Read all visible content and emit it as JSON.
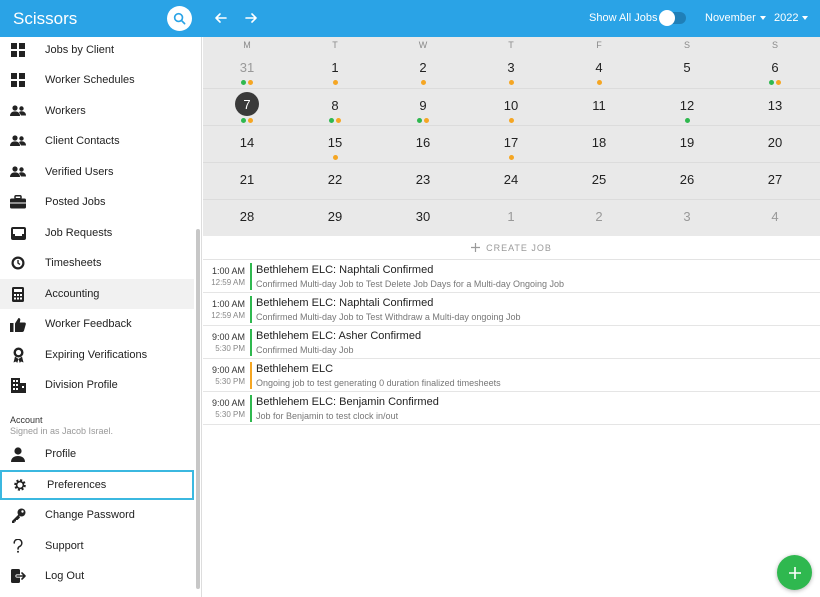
{
  "topbar": {
    "title": "Scissors",
    "show_all_jobs_label": "Show All Jobs",
    "show_all_jobs_on": false,
    "month": "November",
    "year": "2022",
    "accent": "#2aa3e6"
  },
  "sidebar": {
    "items": [
      {
        "label": "Jobs by Client",
        "icon": "grid-icon"
      },
      {
        "label": "Worker Schedules",
        "icon": "grid-icon"
      },
      {
        "label": "Workers",
        "icon": "people-icon"
      },
      {
        "label": "Client Contacts",
        "icon": "people-icon"
      },
      {
        "label": "Verified Users",
        "icon": "people-icon"
      },
      {
        "label": "Posted Jobs",
        "icon": "briefcase-icon"
      },
      {
        "label": "Job Requests",
        "icon": "inbox-icon"
      },
      {
        "label": "Timesheets",
        "icon": "clock-icon"
      },
      {
        "label": "Accounting",
        "icon": "calculator-icon"
      },
      {
        "label": "Worker Feedback",
        "icon": "thumbs-up-icon"
      },
      {
        "label": "Expiring Verifications",
        "icon": "badge-icon"
      },
      {
        "label": "Division Profile",
        "icon": "building-icon"
      }
    ],
    "account_heading": "Account",
    "signed_in_as": "Signed in as Jacob Israel.",
    "account_items": [
      {
        "label": "Profile",
        "icon": "person-icon"
      },
      {
        "label": "Preferences",
        "icon": "gear-icon"
      },
      {
        "label": "Change Password",
        "icon": "key-icon"
      },
      {
        "label": "Support",
        "icon": "question-icon"
      },
      {
        "label": "Log Out",
        "icon": "logout-icon"
      }
    ]
  },
  "calendar": {
    "weekdays": [
      "M",
      "T",
      "W",
      "T",
      "F",
      "S",
      "S"
    ],
    "weeks": [
      [
        {
          "d": "31",
          "muted": true,
          "dots": [
            "g",
            "o"
          ]
        },
        {
          "d": "1",
          "dots": [
            "o"
          ]
        },
        {
          "d": "2",
          "dots": [
            "o"
          ]
        },
        {
          "d": "3",
          "dots": [
            "o"
          ]
        },
        {
          "d": "4",
          "dots": [
            "o"
          ]
        },
        {
          "d": "5",
          "dots": []
        },
        {
          "d": "6",
          "dots": [
            "g",
            "o"
          ]
        }
      ],
      [
        {
          "d": "7",
          "today": true,
          "dots": [
            "g",
            "o"
          ]
        },
        {
          "d": "8",
          "dots": [
            "g",
            "o"
          ]
        },
        {
          "d": "9",
          "dots": [
            "g",
            "o"
          ]
        },
        {
          "d": "10",
          "dots": [
            "o"
          ]
        },
        {
          "d": "11",
          "dots": []
        },
        {
          "d": "12",
          "dots": [
            "g"
          ]
        },
        {
          "d": "13",
          "dots": []
        }
      ],
      [
        {
          "d": "14",
          "dots": []
        },
        {
          "d": "15",
          "dots": [
            "o"
          ]
        },
        {
          "d": "16",
          "dots": []
        },
        {
          "d": "17",
          "dots": [
            "o"
          ]
        },
        {
          "d": "18",
          "dots": []
        },
        {
          "d": "19",
          "dots": []
        },
        {
          "d": "20",
          "dots": []
        }
      ],
      [
        {
          "d": "21",
          "dots": []
        },
        {
          "d": "22",
          "dots": []
        },
        {
          "d": "23",
          "dots": []
        },
        {
          "d": "24",
          "dots": []
        },
        {
          "d": "25",
          "dots": []
        },
        {
          "d": "26",
          "dots": []
        },
        {
          "d": "27",
          "dots": []
        }
      ],
      [
        {
          "d": "28",
          "dots": []
        },
        {
          "d": "29",
          "dots": []
        },
        {
          "d": "30",
          "dots": []
        },
        {
          "d": "1",
          "muted": true,
          "dots": []
        },
        {
          "d": "2",
          "muted": true,
          "dots": []
        },
        {
          "d": "3",
          "muted": true,
          "dots": []
        },
        {
          "d": "4",
          "muted": true,
          "dots": []
        }
      ]
    ],
    "dot_colors": {
      "g": "#2fb84f",
      "o": "#f5a623"
    }
  },
  "create_job_label": "CREATE JOB",
  "jobs": [
    {
      "start": "1:00 AM",
      "end": "12:59 AM",
      "title": "Bethlehem ELC: Naphtali Confirmed",
      "desc": "Confirmed Multi-day Job to Test Delete Job Days for a Multi-day Ongoing Job",
      "bar": "#2fb84f"
    },
    {
      "start": "1:00 AM",
      "end": "12:59 AM",
      "title": "Bethlehem ELC: Naphtali Confirmed",
      "desc": "Confirmed Multi-day Job to Test Withdraw a Multi-day ongoing Job",
      "bar": "#2fb84f"
    },
    {
      "start": "9:00 AM",
      "end": "5:30 PM",
      "title": "Bethlehem ELC: Asher Confirmed",
      "desc": "Confirmed Multi-day Job",
      "bar": "#2fb84f"
    },
    {
      "start": "9:00 AM",
      "end": "5:30 PM",
      "title": "Bethlehem ELC",
      "desc": "Ongoing job to test generating 0 duration finalized timesheets",
      "bar": "#f5a623"
    },
    {
      "start": "9:00 AM",
      "end": "5:30 PM",
      "title": "Bethlehem ELC: Benjamin Confirmed",
      "desc": "Job for Benjamin to test clock in/out",
      "bar": "#2fb84f"
    }
  ]
}
